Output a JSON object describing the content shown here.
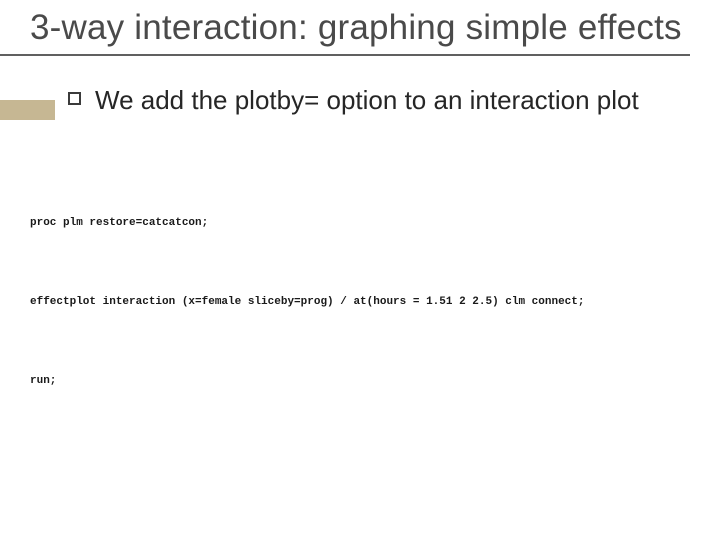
{
  "title": "3-way interaction: graphing simple effects",
  "bullet": "We add the plotby= option to an interaction plot",
  "code": {
    "line1": "proc plm restore=catcatcon;",
    "line2": "effectplot interaction (x=female sliceby=prog) / at(hours = 1.51 2 2.5) clm connect;",
    "line3": "run;"
  }
}
